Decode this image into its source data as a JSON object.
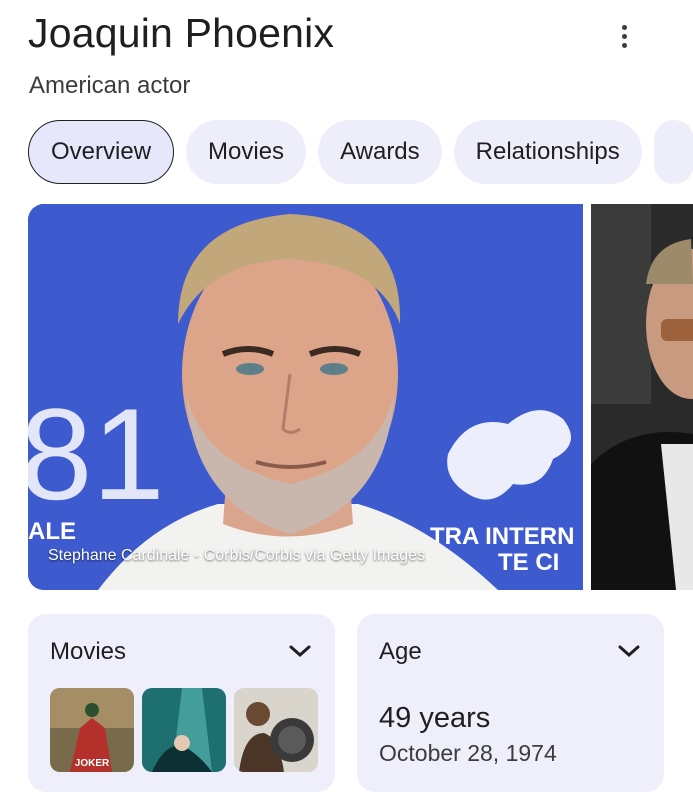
{
  "header": {
    "title": "Joaquin Phoenix",
    "subtitle": "American actor",
    "menu_icon": "more-vert-icon"
  },
  "tabs": [
    {
      "label": "Overview",
      "active": true
    },
    {
      "label": "Movies",
      "active": false
    },
    {
      "label": "Awards",
      "active": false
    },
    {
      "label": "Relationships",
      "active": false
    }
  ],
  "photos": {
    "main_credit": "Stephane Cardinale - Corbis/Corbis via Getty Images",
    "backdrop_text": {
      "left_number": "81",
      "left_word": "ALE",
      "right_line1": "TRA INTERN",
      "right_line2": "TE CI"
    }
  },
  "cards": {
    "movies": {
      "title": "Movies",
      "thumbnails": [
        "Joker poster",
        "Joker: Folie à Deux poster",
        "Gladiator poster"
      ],
      "thumb_caption": "JOKER"
    },
    "age": {
      "title": "Age",
      "value": "49 years",
      "birth_date": "October 28, 1974"
    }
  },
  "colors": {
    "chip_bg": "#eeeefa",
    "card_bg": "#eeeffa",
    "backdrop_blue": "#3d5acf"
  }
}
